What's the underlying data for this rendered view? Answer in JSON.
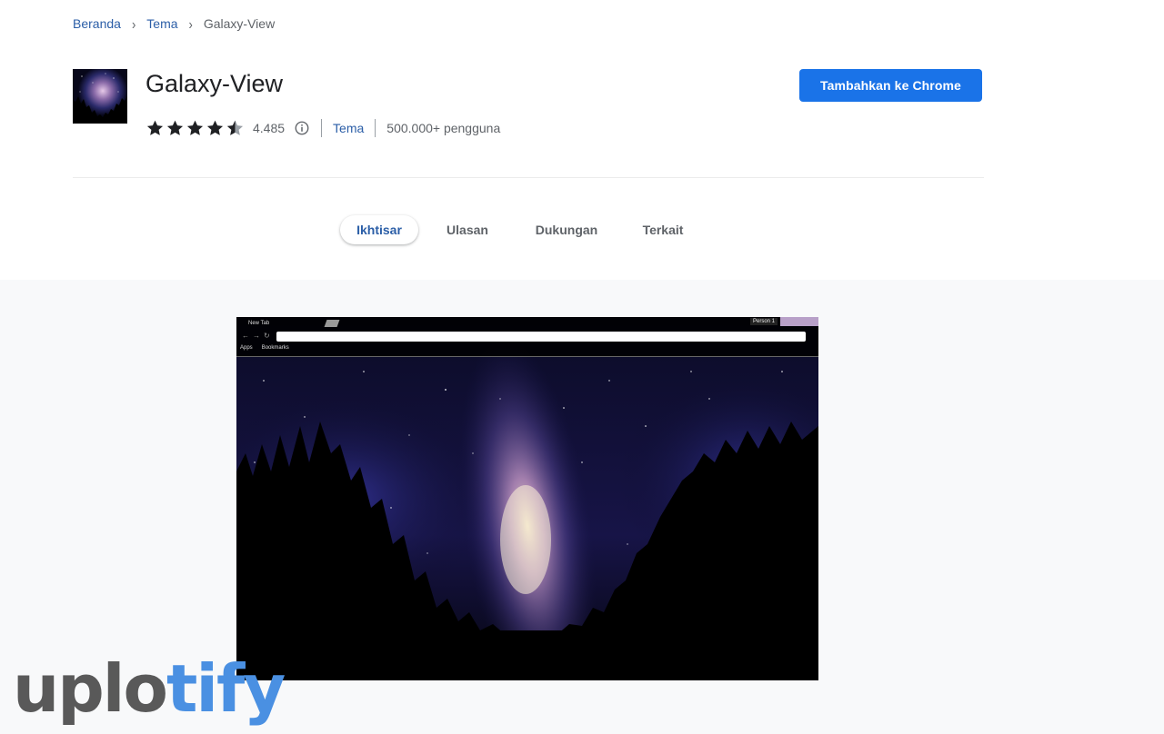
{
  "breadcrumb": {
    "home": "Beranda",
    "category": "Tema",
    "current": "Galaxy-View"
  },
  "extension": {
    "title": "Galaxy-View",
    "rating": 4.5,
    "rating_count": "4.485",
    "category": "Tema",
    "users": "500.000+ pengguna",
    "add_button": "Tambahkan ke Chrome"
  },
  "tabs": [
    {
      "label": "Ikhtisar",
      "active": true
    },
    {
      "label": "Ulasan",
      "active": false
    },
    {
      "label": "Dukungan",
      "active": false
    },
    {
      "label": "Terkait",
      "active": false
    }
  ],
  "preview": {
    "tab_title": "New Tab",
    "profile": "Person 1",
    "bookmark_apps": "Apps",
    "bookmark_bookmarks": "Bookmarks"
  },
  "watermark": {
    "part1": "uplo",
    "part2": "tify"
  },
  "colors": {
    "accent": "#1a73e8",
    "link": "#2b5ea7",
    "muted": "#5f6368"
  }
}
